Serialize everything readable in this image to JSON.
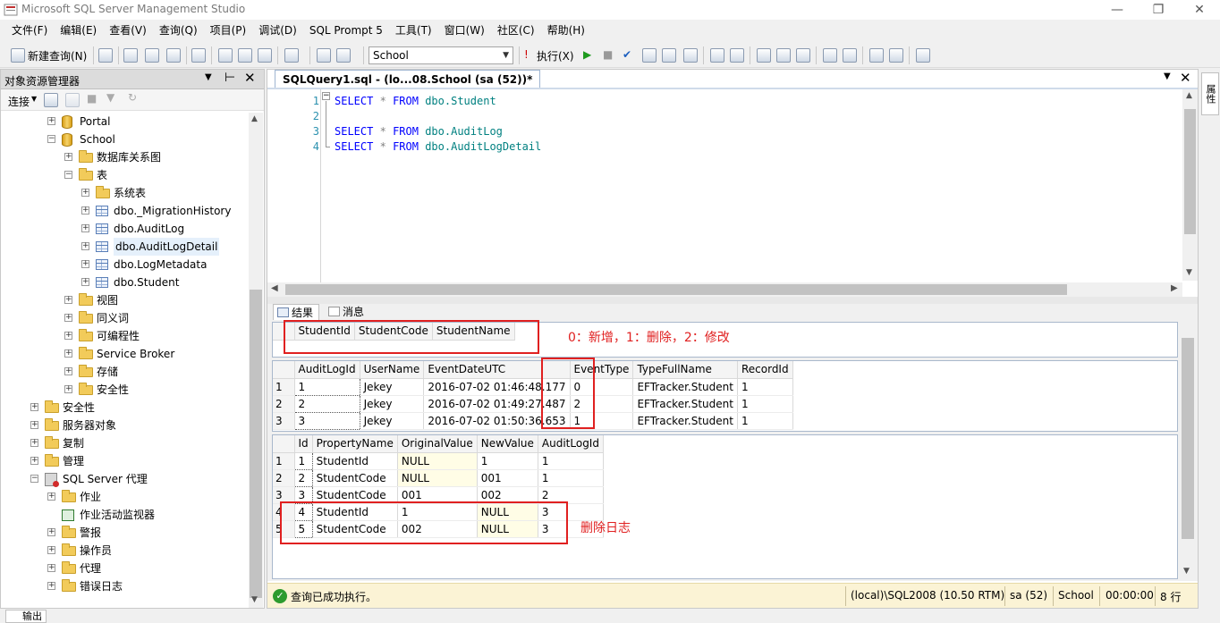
{
  "window": {
    "title": "Microsoft SQL Server Management Studio"
  },
  "menu": [
    "文件(F)",
    "编辑(E)",
    "查看(V)",
    "查询(Q)",
    "项目(P)",
    "调试(D)",
    "SQL Prompt 5",
    "工具(T)",
    "窗口(W)",
    "社区(C)",
    "帮助(H)"
  ],
  "toolbar": {
    "new_query": "新建查询(N)",
    "database": "School",
    "execute": "执行(X)"
  },
  "object_explorer": {
    "title": "对象资源管理器",
    "connect": "连接",
    "tree": [
      {
        "label": "Portal",
        "icon": "database-icon",
        "expander": "+"
      },
      {
        "label": "School",
        "icon": "database-icon",
        "expander": "−"
      },
      {
        "label": "数据库关系图",
        "icon": "folder-icon",
        "expander": "+"
      },
      {
        "label": "表",
        "icon": "folder-icon",
        "expander": "−"
      },
      {
        "label": "系统表",
        "icon": "folder-icon",
        "expander": "+"
      },
      {
        "label": "dbo._MigrationHistory",
        "icon": "table-icon",
        "expander": "+"
      },
      {
        "label": "dbo.AuditLog",
        "icon": "table-icon",
        "expander": "+"
      },
      {
        "label": "dbo.AuditLogDetail",
        "icon": "table-icon",
        "expander": "+"
      },
      {
        "label": "dbo.LogMetadata",
        "icon": "table-icon",
        "expander": "+"
      },
      {
        "label": "dbo.Student",
        "icon": "table-icon",
        "expander": "+"
      },
      {
        "label": "视图",
        "icon": "folder-icon",
        "expander": "+"
      },
      {
        "label": "同义词",
        "icon": "folder-icon",
        "expander": "+"
      },
      {
        "label": "可编程性",
        "icon": "folder-icon",
        "expander": "+"
      },
      {
        "label": "Service Broker",
        "icon": "folder-icon",
        "expander": "+"
      },
      {
        "label": "存储",
        "icon": "folder-icon",
        "expander": "+"
      },
      {
        "label": "安全性",
        "icon": "folder-icon",
        "expander": "+"
      },
      {
        "label": "安全性",
        "icon": "folder-icon",
        "expander": "+"
      },
      {
        "label": "服务器对象",
        "icon": "folder-icon",
        "expander": "+"
      },
      {
        "label": "复制",
        "icon": "folder-icon",
        "expander": "+"
      },
      {
        "label": "管理",
        "icon": "folder-icon",
        "expander": "+"
      },
      {
        "label": "SQL Server 代理",
        "icon": "agent-icon",
        "expander": "−"
      },
      {
        "label": "作业",
        "icon": "folder-icon",
        "expander": "+"
      },
      {
        "label": "作业活动监视器",
        "icon": "monitor-icon",
        "expander": ""
      },
      {
        "label": "警报",
        "icon": "folder-icon",
        "expander": "+"
      },
      {
        "label": "操作员",
        "icon": "folder-icon",
        "expander": "+"
      },
      {
        "label": "代理",
        "icon": "folder-icon",
        "expander": "+"
      },
      {
        "label": "错误日志",
        "icon": "folder-icon",
        "expander": "+"
      }
    ]
  },
  "editor": {
    "tab_title": "SQLQuery1.sql - (lo...08.School (sa (52))*",
    "lines": [
      {
        "num": "1",
        "kw1": "SELECT",
        "op": "*",
        "kw2": "FROM",
        "obj": "dbo.Student"
      },
      {
        "num": "2",
        "kw1": "",
        "op": "",
        "kw2": "",
        "obj": ""
      },
      {
        "num": "3",
        "kw1": "SELECT",
        "op": "*",
        "kw2": "FROM",
        "obj": "dbo.AuditLog"
      },
      {
        "num": "4",
        "kw1": "SELECT",
        "op": "*",
        "kw2": "FROM",
        "obj": "dbo.AuditLogDetail"
      }
    ]
  },
  "results": {
    "tabs": [
      "结果",
      "消息"
    ],
    "grid1": {
      "columns": [
        "StudentId",
        "StudentCode",
        "StudentName"
      ],
      "rows": []
    },
    "grid2": {
      "columns": [
        "AuditLogId",
        "UserName",
        "EventDateUTC",
        "EventType",
        "TypeFullName",
        "RecordId"
      ],
      "rows": [
        [
          "1",
          "1",
          "Jekey",
          "2016-07-02 01:46:48.177",
          "0",
          "EFTracker.Student",
          "1"
        ],
        [
          "2",
          "2",
          "Jekey",
          "2016-07-02 01:49:27.487",
          "2",
          "EFTracker.Student",
          "1"
        ],
        [
          "3",
          "3",
          "Jekey",
          "2016-07-02 01:50:36.653",
          "1",
          "EFTracker.Student",
          "1"
        ]
      ]
    },
    "grid3": {
      "columns": [
        "Id",
        "PropertyName",
        "OriginalValue",
        "NewValue",
        "AuditLogId"
      ],
      "rows": [
        [
          "1",
          "1",
          "StudentId",
          "NULL",
          "1",
          "1"
        ],
        [
          "2",
          "2",
          "StudentCode",
          "NULL",
          "001",
          "1"
        ],
        [
          "3",
          "3",
          "StudentCode",
          "001",
          "002",
          "2"
        ],
        [
          "4",
          "4",
          "StudentId",
          "1",
          "NULL",
          "3"
        ],
        [
          "5",
          "5",
          "StudentCode",
          "002",
          "NULL",
          "3"
        ]
      ]
    },
    "annotation_eventtype": "0：新增，1：删除，2：修改",
    "annotation_delete": "删除日志"
  },
  "status": {
    "message": "查询已成功执行。",
    "server": "(local)\\SQL2008 (10.50 RTM)",
    "user": "sa (52)",
    "database": "School",
    "elapsed": "00:00:00",
    "rows": "8 行"
  },
  "properties_tab": "属性",
  "output_tab": "输出",
  "colors": {
    "annotation": "#e02020",
    "status_bg": "#fbf3d5",
    "keyword": "#0000ff",
    "object": "#008080"
  }
}
